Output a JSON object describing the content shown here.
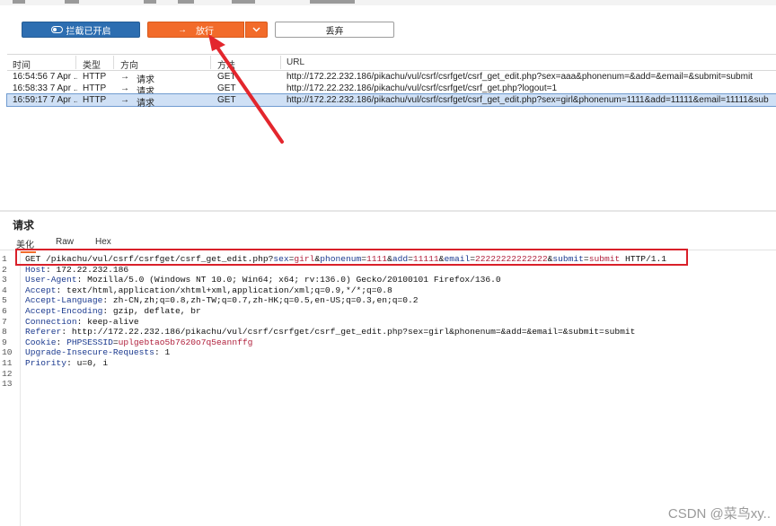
{
  "toolbar": {
    "intercept_label": "拦截已开启",
    "forward_label": "放行",
    "drop_label": "丢弃"
  },
  "history": {
    "columns": [
      "时间",
      "类型",
      "方向",
      "方法",
      "URL"
    ],
    "rows": [
      {
        "time": "16:54:56 7 Apr ...",
        "type": "HTTP",
        "direction": "请求",
        "method": "GET",
        "url": "http://172.22.232.186/pikachu/vul/csrf/csrfget/csrf_get_edit.php?sex=aaa&phonenum=&add=&email=&submit=submit",
        "selected": false
      },
      {
        "time": "16:58:33 7 Apr ...",
        "type": "HTTP",
        "direction": "请求",
        "method": "GET",
        "url": "http://172.22.232.186/pikachu/vul/csrf/csrfget/csrf_get.php?logout=1",
        "selected": false
      },
      {
        "time": "16:59:17 7 Apr ...",
        "type": "HTTP",
        "direction": "请求",
        "method": "GET",
        "url": "http://172.22.232.186/pikachu/vul/csrf/csrfget/csrf_get_edit.php?sex=girl&phonenum=1111&add=11111&email=11111&sub",
        "selected": true
      }
    ]
  },
  "request": {
    "title": "请求",
    "tabs": [
      "美化",
      "Raw",
      "Hex"
    ],
    "active_tab": "美化",
    "lines": [
      {
        "n": "1",
        "text": "GET /pikachu/vul/csrf/csrfget/csrf_get_edit.php?sex=girl&phonenum=1111&add=11111&email=22222222222222&submit=submit HTTP/1.1"
      },
      {
        "n": "2",
        "text": "Host: 172.22.232.186"
      },
      {
        "n": "3",
        "text": "User-Agent: Mozilla/5.0 (Windows NT 10.0; Win64; x64; rv:136.0) Gecko/20100101 Firefox/136.0"
      },
      {
        "n": "4",
        "text": "Accept: text/html,application/xhtml+xml,application/xml;q=0.9,*/*;q=0.8"
      },
      {
        "n": "5",
        "text": "Accept-Language: zh-CN,zh;q=0.8,zh-TW;q=0.7,zh-HK;q=0.5,en-US;q=0.3,en;q=0.2"
      },
      {
        "n": "6",
        "text": "Accept-Encoding: gzip, deflate, br"
      },
      {
        "n": "7",
        "text": "Connection: keep-alive"
      },
      {
        "n": "8",
        "text": "Referer: http://172.22.232.186/pikachu/vul/csrf/csrfget/csrf_get_edit.php?sex=girl&phonenum=&add=&email=&submit=submit"
      },
      {
        "n": "9",
        "text": "Cookie: PHPSESSID=uplgebtao5b7620o7q5eannffg"
      },
      {
        "n": "10",
        "text": "Upgrade-Insecure-Requests: 1"
      },
      {
        "n": "11",
        "text": "Priority: u=0, i"
      },
      {
        "n": "12",
        "text": ""
      },
      {
        "n": "13",
        "text": ""
      }
    ]
  },
  "watermark": "CSDN @菜鸟xy.."
}
